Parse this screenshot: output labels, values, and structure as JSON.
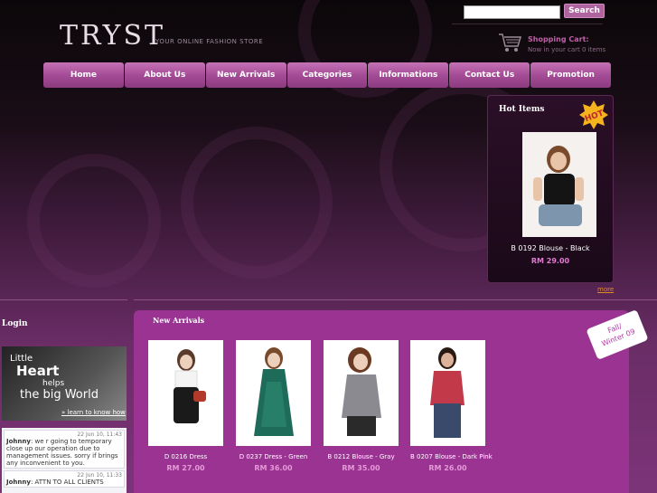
{
  "header": {
    "logo": "TRYST",
    "tagline": "YOUR ONLINE FASHION STORE",
    "search": {
      "value": "",
      "button": "Search"
    },
    "cart": {
      "title": "Shopping Cart:",
      "info": "Now in your cart 0 items"
    }
  },
  "nav": [
    "Home",
    "About Us",
    "New Arrivals",
    "Categories",
    "Informations",
    "Contact Us",
    "Promotion"
  ],
  "hot_items": {
    "title": "Hot Items",
    "badge": "HOT",
    "product": {
      "name": "B 0192 Blouse - Black",
      "price": "RM 29.00"
    },
    "more": "more"
  },
  "login": {
    "title": "Login"
  },
  "promo": {
    "line1": "Little",
    "line2": "Heart",
    "line3": "helps",
    "line4": "the big World",
    "link": "» learn to know how"
  },
  "shoutbox": [
    {
      "time": "22 Jun 10, 11:43",
      "user": "Johnny",
      "message": ": we r going to temporary close up our operation due to management issues. sorry if brings any inconvenient to you."
    },
    {
      "time": "22 Jun 10, 11:33",
      "user": "Johnny",
      "message": ": ATTN TO ALL CLIENTS"
    }
  ],
  "new_arrivals": {
    "title": "New Arrivals",
    "tag": [
      "Fall/",
      "Winter 09"
    ],
    "products": [
      {
        "name": "D 0216 Dress",
        "price": "RM 27.00",
        "color": "#1a1a1a"
      },
      {
        "name": "D 0237 Dress - Green",
        "price": "RM 36.00",
        "color": "#1f6b5a"
      },
      {
        "name": "B 0212 Blouse - Gray",
        "price": "RM 35.00",
        "color": "#8a8a90"
      },
      {
        "name": "B 0207 Blouse - Dark Pink",
        "price": "RM 26.00",
        "color": "#c23a4a"
      }
    ]
  }
}
